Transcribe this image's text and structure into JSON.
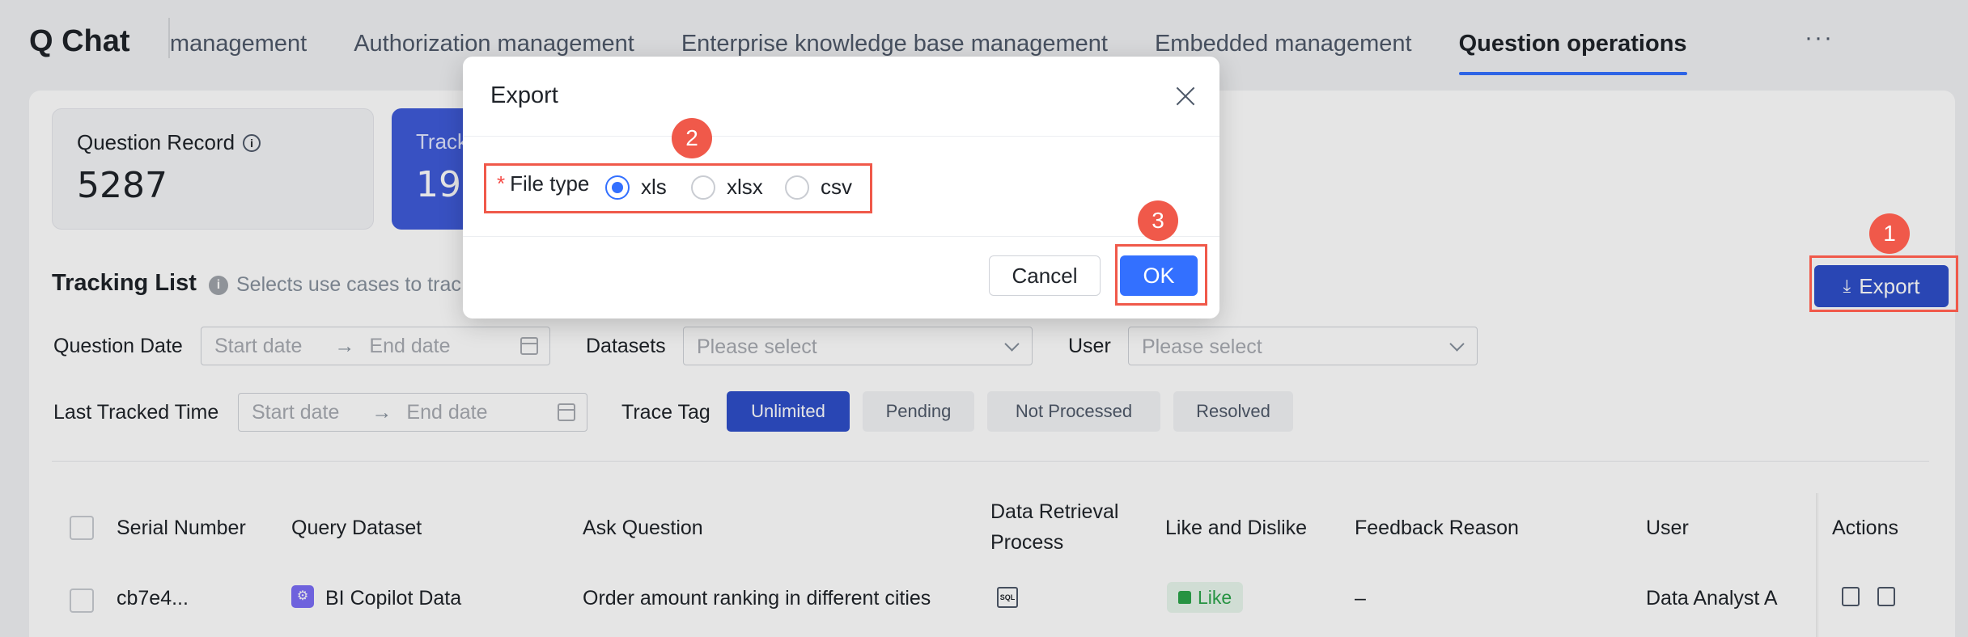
{
  "app": {
    "title": "Q Chat"
  },
  "nav": {
    "tabs": [
      {
        "label": "Dashboard management",
        "active": false
      },
      {
        "label": "Authorization management",
        "active": false
      },
      {
        "label": "Enterprise knowledge base management",
        "active": false
      },
      {
        "label": "Embedded management",
        "active": false
      },
      {
        "label": "Question operations",
        "active": true
      }
    ],
    "more": "···"
  },
  "stats": {
    "record": {
      "label": "Question Record",
      "value": "5287"
    },
    "tracking": {
      "label": "Track",
      "value": "19"
    }
  },
  "tracking_list": {
    "title": "Tracking List",
    "note": "Selects use cases to trac",
    "export_label": "Export"
  },
  "filters": {
    "question_date": {
      "label": "Question Date",
      "start": "Start date",
      "end": "End date"
    },
    "datasets": {
      "label": "Datasets",
      "placeholder": "Please select"
    },
    "user": {
      "label": "User",
      "placeholder": "Please select"
    },
    "last_tracked": {
      "label": "Last Tracked Time",
      "start": "Start date",
      "end": "End date"
    },
    "trace_tag": {
      "label": "Trace Tag",
      "options": [
        "Unlimited",
        "Pending",
        "Not Processed",
        "Resolved"
      ],
      "selected": "Unlimited"
    },
    "arrow": "→"
  },
  "table": {
    "columns": [
      "Serial Number",
      "Query Dataset",
      "Ask Question",
      "Data Retrieval",
      "Process",
      "Like and Dislike",
      "Feedback Reason",
      "User",
      "Actions"
    ],
    "rows": [
      {
        "serial": "cb7e4...",
        "dataset": "BI Copilot Data",
        "question": "Order amount ranking in different cities",
        "process_icon": "SQL",
        "feedback": "Like",
        "reason": "–",
        "user": "Data Analyst A"
      }
    ]
  },
  "modal": {
    "title": "Export",
    "field_label": "File type",
    "required_mark": "*",
    "options": [
      "xls",
      "xlsx",
      "csv"
    ],
    "selected": "xls",
    "cancel_label": "Cancel",
    "ok_label": "OK"
  },
  "annotations": [
    "1",
    "2",
    "3"
  ],
  "colors": {
    "accent": "#3370ff",
    "primary_button": "#2e4fc9",
    "highlight": "#f0594a",
    "like_green": "#2ba44a"
  }
}
